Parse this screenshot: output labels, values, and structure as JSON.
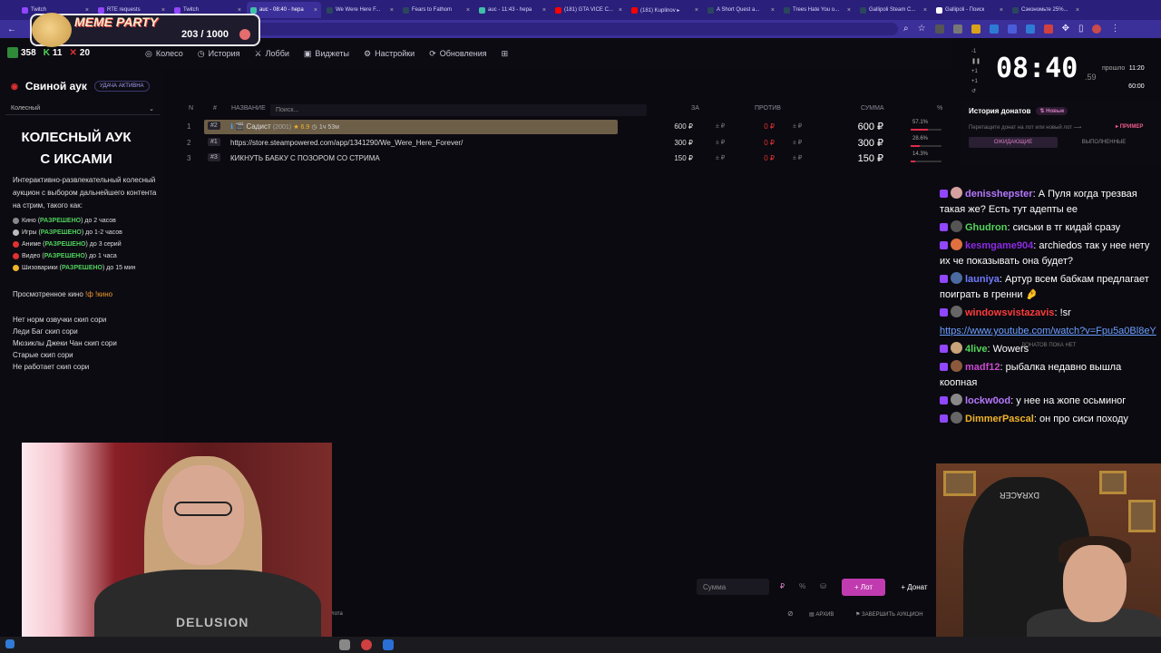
{
  "browser": {
    "tabs": [
      {
        "label": "Twitch",
        "color": "#9146ff"
      },
      {
        "label": "RTE requests",
        "color": "#9146ff"
      },
      {
        "label": "Twitch",
        "color": "#9146ff"
      },
      {
        "label": "auc - 08:40 - hepa",
        "color": "#3fbfa8",
        "active": true
      },
      {
        "label": "We Were Here F...",
        "color": "#2a475e"
      },
      {
        "label": "Fears to Fathom",
        "color": "#2a475e"
      },
      {
        "label": "auc - 11:43 - hepa",
        "color": "#3fbfa8"
      },
      {
        "label": "(181) GTA VICE C...",
        "color": "#ff0000"
      },
      {
        "label": "(181) Kuplinov ▸",
        "color": "#ff0000"
      },
      {
        "label": "A Short Quest a...",
        "color": "#2a475e"
      },
      {
        "label": "Trees Hate You o...",
        "color": "#2a475e"
      },
      {
        "label": "Gallipoli Steam C...",
        "color": "#2a475e"
      },
      {
        "label": "Gallipoli - Поиск",
        "color": "#ffffff"
      },
      {
        "label": "Сэкономьте 25%...",
        "color": "#2a475e"
      }
    ]
  },
  "overlay": {
    "meme_title": "MEME PARTY",
    "meme_count": "203 / 1000"
  },
  "stats": {
    "points": "358",
    "k": "11",
    "x": "20"
  },
  "nav": {
    "items": [
      {
        "icon": "wheel-icon",
        "label": "Колесо"
      },
      {
        "icon": "history-icon",
        "label": "История"
      },
      {
        "icon": "lobby-icon",
        "label": "Лобби"
      },
      {
        "icon": "widgets-icon",
        "label": "Виджеты"
      },
      {
        "icon": "settings-icon",
        "label": "Настройки"
      },
      {
        "icon": "updates-icon",
        "label": "Обновления"
      }
    ]
  },
  "timer": {
    "value": "08:40",
    "ms": ".59",
    "passed_label": "прошло",
    "passed_value": "11:20",
    "goal_label": "",
    "goal_value": "60:00",
    "side": [
      "-1",
      "+1",
      "+1"
    ]
  },
  "sidebar": {
    "title": "Свиной аук",
    "badge": "УДАЧА АКТИВНА",
    "select": "Колесный",
    "big_title_1": "КОЛЕСНЫЙ АУК",
    "big_title_2": "С ИКСАМИ",
    "desc": "Интерактивно-развлекательный колесный аукцион с выбором дальнейшего контента на стрим, такого как:",
    "rules": [
      {
        "name": "Кино",
        "ok": "РАЗРЕШЕНО",
        "limit": "до 2 часов",
        "color": "#888"
      },
      {
        "name": "Игры",
        "ok": "РАЗРЕШЕНО",
        "limit": "до 1-2 часов",
        "color": "#bbb"
      },
      {
        "name": "Аниме",
        "ok": "РАЗРЕШЕНО",
        "limit": "до 3 серий",
        "color": "#e03131"
      },
      {
        "name": "Видео",
        "ok": "РАЗРЕШЕНО",
        "limit": "до 1 часа",
        "color": "#e03131"
      },
      {
        "name": "Шизоварики",
        "ok": "РАЗРЕШЕНО",
        "limit": "до 15 мин",
        "color": "#f0b429"
      }
    ],
    "watched_label": "Просмотренное кино",
    "watched_cmd": "!ф !кино",
    "skips": [
      "Нет норм озвучки скип сори",
      "Леди Баг скип сори",
      "Мюзиклы Джеки Чан скип сори",
      "Старые скип сори",
      "Не работает скип сори"
    ]
  },
  "table": {
    "headers": {
      "n": "N",
      "hash": "#",
      "name": "НАЗВАНИЕ",
      "for": "ЗА",
      "against": "ПРОТИВ",
      "sum": "СУММА",
      "pct": "%"
    },
    "search_placeholder": "Поиск...",
    "rows": [
      {
        "n": "1",
        "hash": "#2",
        "name": "Садист",
        "year": "(2001)",
        "rating": "★ 6.9",
        "duration": "1ч 53м",
        "for": "600 ₽",
        "for_plus": "± ₽",
        "against": "0 ₽",
        "against_plus": "± ₽",
        "sum": "600 ₽",
        "pct": "57.1%",
        "pct_value": 57.1
      },
      {
        "n": "2",
        "hash": "#1",
        "name": "https://store.steampowered.com/app/1341290/We_Were_Here_Forever/",
        "for": "300 ₽",
        "for_plus": "± ₽",
        "against": "0 ₽",
        "against_plus": "± ₽",
        "sum": "300 ₽",
        "pct": "28.6%",
        "pct_value": 28.6
      },
      {
        "n": "3",
        "hash": "#3",
        "name": "КИКНУТЬ БАБКУ С ПОЗОРОМ СО СТРИМА",
        "for": "150 ₽",
        "for_plus": "± ₽",
        "against": "0 ₽",
        "against_plus": "± ₽",
        "sum": "150 ₽",
        "pct": "14.3%",
        "pct_value": 14.3
      }
    ]
  },
  "footer": {
    "amount_placeholder": "Сумма",
    "currency": "₽",
    "percent": "%",
    "lot_button": "+ Лот",
    "donate_button": "+ Донат",
    "left_label": "лота",
    "archive": "АРХИВ",
    "finish": "ЗАВЕРШИТЬ АУКЦИОН"
  },
  "donations": {
    "title": "История донатов",
    "new_badge": "Новые",
    "hint": "Перетащите донат на лот или новый лот ⟶",
    "example": "ПРИМЕР",
    "tab_pending": "ОЖИДАЮЩИЕ",
    "tab_done": "ВЫПОЛНЕННЫЕ",
    "empty": "ДОНАТОВ ПОКА НЕТ"
  },
  "chat": {
    "messages": [
      {
        "nick": "denisshepster",
        "nick_color": "#b678ff",
        "avatar": "#d4a0a0",
        "text": "А Пуля когда трезвая такая же? Есть тут адепты ее"
      },
      {
        "nick": "Ghudron",
        "nick_color": "#52d65b",
        "avatar": "#555",
        "text": "сиськи в тг кидай сразу"
      },
      {
        "nick": "kesmgame904",
        "nick_color": "#8a2be2",
        "avatar": "#e07040",
        "text": "archiedos так у нее нету их че показывать она будет?"
      },
      {
        "nick": "launiya",
        "nick_color": "#6f7bff",
        "avatar": "#4a6aa0",
        "text": "Артур всем бабкам предлагает поиграть в гренни 🤌"
      },
      {
        "nick": "windowsvistazavis",
        "nick_color": "#ff3b3b",
        "avatar": "#666",
        "text": "!sr"
      },
      {
        "link": "https://www.youtube.com/watch?v=Fpu5a0Bl8eY"
      },
      {
        "nick": "4live",
        "nick_color": "#52d65b",
        "avatar": "#c9a37a",
        "text": "Wowers"
      },
      {
        "nick": "madf12",
        "nick_color": "#c94ad0",
        "avatar": "#8b5a3c",
        "text": "рыбалка недавно вышла коопная"
      },
      {
        "nick": "lockw0od",
        "nick_color": "#b678ff",
        "avatar": "#888",
        "text": "у нее на жопе осьминог"
      },
      {
        "nick": "DimmerPascal",
        "nick_color": "#f0b429",
        "avatar": "#666",
        "text": "он про сиси походу"
      }
    ]
  },
  "cam_left": {
    "shirt_text": "DELUSION"
  },
  "cam_right": {
    "chair_logo": "DXRACER"
  }
}
